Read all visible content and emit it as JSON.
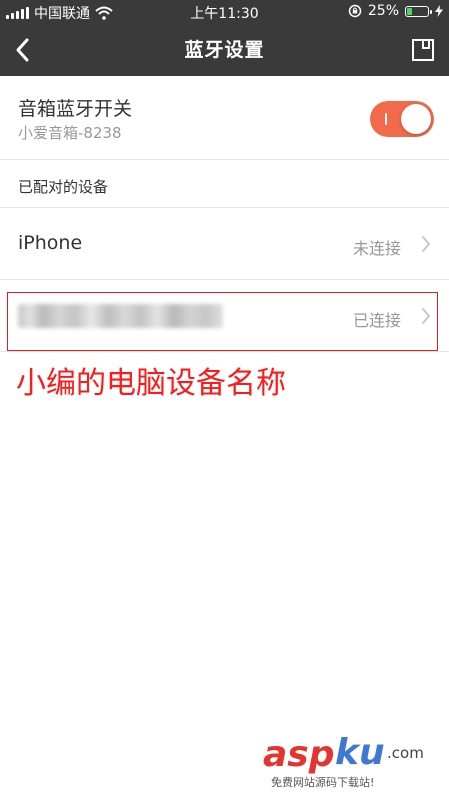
{
  "status_bar": {
    "carrier": "中国联通",
    "time": "上午11:30",
    "battery_percent": "25%",
    "battery_level": 0.25
  },
  "nav": {
    "title": "蓝牙设置"
  },
  "speaker": {
    "title": "音箱蓝牙开关",
    "subtitle": "小爱音箱-8238",
    "toggle_on": true
  },
  "paired": {
    "header": "已配对的设备",
    "devices": [
      {
        "name": "iPhone",
        "status": "未连接"
      },
      {
        "name": "",
        "status": "已连接"
      }
    ]
  },
  "annotation": "小编的电脑设备名称",
  "watermark": {
    "asp": "asp",
    "ku": "ku",
    "com": ".com",
    "sub": "免费网站源码下载站!"
  },
  "colors": {
    "bar_background": "#3a3a3a",
    "toggle_on": "#f26a4b",
    "annotation_red": "#ff1a1a",
    "battery_green": "#4cd964"
  },
  "icons": {
    "back": "back-chevron-icon",
    "save": "save-icon",
    "row_chevron": "chevron-right-icon",
    "wifi": "wifi-icon",
    "signal": "signal-icon",
    "rotation_lock": "rotation-lock-icon",
    "charging": "charging-bolt-icon"
  }
}
